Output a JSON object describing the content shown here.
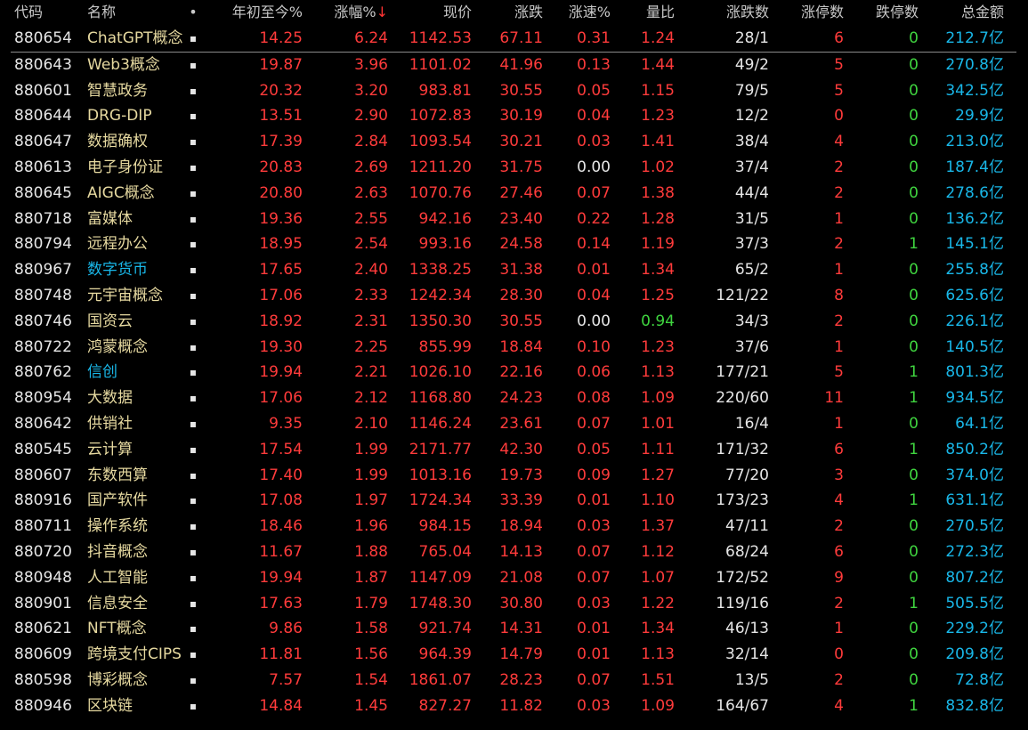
{
  "colors": {
    "up": "#ff3b3b",
    "down": "#3fd43f",
    "neutral": "#e6e6e6",
    "code": "#e6e6e6",
    "name_default": "#e6d9a0",
    "name_highlight": "#19b7e8",
    "amount": "#19b7e8"
  },
  "columns": {
    "code": "代码",
    "name": "名称",
    "dot": "•",
    "ytd": "年初至今%",
    "change": "涨幅%",
    "sort_indicator": "↓",
    "price": "现价",
    "delta": "涨跌",
    "speed": "涨速%",
    "volume_ratio": "量比",
    "adv_dec": "涨跌数",
    "limit_up": "涨停数",
    "limit_down": "跌停数",
    "amount": "总金额"
  },
  "rows": [
    {
      "code": "880654",
      "name": "ChatGPT概念",
      "dot": "▪",
      "ytd": "14.25",
      "change": "6.24",
      "price": "1142.53",
      "delta": "67.11",
      "speed": "0.31",
      "vr": "1.24",
      "adv": "28/1",
      "lu": "6",
      "ld": "0",
      "amt": "212.7亿",
      "vr_color": "up",
      "speed_color": "up",
      "name_color": "name_default"
    },
    {
      "code": "880643",
      "name": "Web3概念",
      "dot": "▪",
      "ytd": "19.87",
      "change": "3.96",
      "price": "1101.02",
      "delta": "41.96",
      "speed": "0.13",
      "vr": "1.44",
      "adv": "49/2",
      "lu": "5",
      "ld": "0",
      "amt": "270.8亿",
      "vr_color": "up",
      "speed_color": "up",
      "name_color": "name_default"
    },
    {
      "code": "880601",
      "name": "智慧政务",
      "dot": "▪",
      "ytd": "20.32",
      "change": "3.20",
      "price": "983.81",
      "delta": "30.55",
      "speed": "0.05",
      "vr": "1.15",
      "adv": "79/5",
      "lu": "5",
      "ld": "0",
      "amt": "342.5亿",
      "vr_color": "up",
      "speed_color": "up",
      "name_color": "name_default"
    },
    {
      "code": "880644",
      "name": "DRG-DIP",
      "dot": "▪",
      "ytd": "13.51",
      "change": "2.90",
      "price": "1072.83",
      "delta": "30.19",
      "speed": "0.04",
      "vr": "1.23",
      "adv": "12/2",
      "lu": "0",
      "ld": "0",
      "amt": "29.9亿",
      "vr_color": "up",
      "speed_color": "up",
      "name_color": "name_default"
    },
    {
      "code": "880647",
      "name": "数据确权",
      "dot": "▪",
      "ytd": "17.39",
      "change": "2.84",
      "price": "1093.54",
      "delta": "30.21",
      "speed": "0.03",
      "vr": "1.41",
      "adv": "38/4",
      "lu": "4",
      "ld": "0",
      "amt": "213.0亿",
      "vr_color": "up",
      "speed_color": "up",
      "name_color": "name_default"
    },
    {
      "code": "880613",
      "name": "电子身份证",
      "dot": "▪",
      "ytd": "20.83",
      "change": "2.69",
      "price": "1211.20",
      "delta": "31.75",
      "speed": "0.00",
      "vr": "1.02",
      "adv": "37/4",
      "lu": "2",
      "ld": "0",
      "amt": "187.4亿",
      "vr_color": "up",
      "speed_color": "neutral",
      "name_color": "name_default"
    },
    {
      "code": "880645",
      "name": "AIGC概念",
      "dot": "▪",
      "ytd": "20.80",
      "change": "2.63",
      "price": "1070.76",
      "delta": "27.46",
      "speed": "0.07",
      "vr": "1.38",
      "adv": "44/4",
      "lu": "2",
      "ld": "0",
      "amt": "278.6亿",
      "vr_color": "up",
      "speed_color": "up",
      "name_color": "name_default"
    },
    {
      "code": "880718",
      "name": "富媒体",
      "dot": "▪",
      "ytd": "19.36",
      "change": "2.55",
      "price": "942.16",
      "delta": "23.40",
      "speed": "0.22",
      "vr": "1.28",
      "adv": "31/5",
      "lu": "1",
      "ld": "0",
      "amt": "136.2亿",
      "vr_color": "up",
      "speed_color": "up",
      "name_color": "name_default"
    },
    {
      "code": "880794",
      "name": "远程办公",
      "dot": "▪",
      "ytd": "18.95",
      "change": "2.54",
      "price": "993.16",
      "delta": "24.58",
      "speed": "0.14",
      "vr": "1.19",
      "adv": "37/3",
      "lu": "2",
      "ld": "1",
      "amt": "145.1亿",
      "vr_color": "up",
      "speed_color": "up",
      "name_color": "name_default"
    },
    {
      "code": "880967",
      "name": "数字货币",
      "dot": "▪",
      "ytd": "17.65",
      "change": "2.40",
      "price": "1338.25",
      "delta": "31.38",
      "speed": "0.01",
      "vr": "1.34",
      "adv": "65/2",
      "lu": "1",
      "ld": "0",
      "amt": "255.8亿",
      "vr_color": "up",
      "speed_color": "up",
      "name_color": "name_highlight"
    },
    {
      "code": "880748",
      "name": "元宇宙概念",
      "dot": "▪",
      "ytd": "17.06",
      "change": "2.33",
      "price": "1242.34",
      "delta": "28.30",
      "speed": "0.04",
      "vr": "1.25",
      "adv": "121/22",
      "lu": "8",
      "ld": "0",
      "amt": "625.6亿",
      "vr_color": "up",
      "speed_color": "up",
      "name_color": "name_default"
    },
    {
      "code": "880746",
      "name": "国资云",
      "dot": "▪",
      "ytd": "18.92",
      "change": "2.31",
      "price": "1350.30",
      "delta": "30.55",
      "speed": "0.00",
      "vr": "0.94",
      "adv": "34/3",
      "lu": "2",
      "ld": "0",
      "amt": "226.1亿",
      "vr_color": "down",
      "speed_color": "neutral",
      "name_color": "name_default"
    },
    {
      "code": "880722",
      "name": "鸿蒙概念",
      "dot": "▪",
      "ytd": "19.30",
      "change": "2.25",
      "price": "855.99",
      "delta": "18.84",
      "speed": "0.10",
      "vr": "1.23",
      "adv": "37/6",
      "lu": "1",
      "ld": "0",
      "amt": "140.5亿",
      "vr_color": "up",
      "speed_color": "up",
      "name_color": "name_default"
    },
    {
      "code": "880762",
      "name": "信创",
      "dot": "▪",
      "ytd": "19.94",
      "change": "2.21",
      "price": "1026.10",
      "delta": "22.16",
      "speed": "0.06",
      "vr": "1.13",
      "adv": "177/21",
      "lu": "5",
      "ld": "1",
      "amt": "801.3亿",
      "vr_color": "up",
      "speed_color": "up",
      "name_color": "name_highlight"
    },
    {
      "code": "880954",
      "name": "大数据",
      "dot": "▪",
      "ytd": "17.06",
      "change": "2.12",
      "price": "1168.80",
      "delta": "24.23",
      "speed": "0.08",
      "vr": "1.09",
      "adv": "220/60",
      "lu": "11",
      "ld": "1",
      "amt": "934.5亿",
      "vr_color": "up",
      "speed_color": "up",
      "name_color": "name_default"
    },
    {
      "code": "880642",
      "name": "供销社",
      "dot": "▪",
      "ytd": "9.35",
      "change": "2.10",
      "price": "1146.24",
      "delta": "23.61",
      "speed": "0.07",
      "vr": "1.01",
      "adv": "16/4",
      "lu": "1",
      "ld": "0",
      "amt": "64.1亿",
      "vr_color": "up",
      "speed_color": "up",
      "name_color": "name_default"
    },
    {
      "code": "880545",
      "name": "云计算",
      "dot": "▪",
      "ytd": "17.54",
      "change": "1.99",
      "price": "2171.77",
      "delta": "42.30",
      "speed": "0.05",
      "vr": "1.11",
      "adv": "171/32",
      "lu": "6",
      "ld": "1",
      "amt": "850.2亿",
      "vr_color": "up",
      "speed_color": "up",
      "name_color": "name_default"
    },
    {
      "code": "880607",
      "name": "东数西算",
      "dot": "▪",
      "ytd": "17.40",
      "change": "1.99",
      "price": "1013.16",
      "delta": "19.73",
      "speed": "0.09",
      "vr": "1.27",
      "adv": "77/20",
      "lu": "3",
      "ld": "0",
      "amt": "374.0亿",
      "vr_color": "up",
      "speed_color": "up",
      "name_color": "name_default"
    },
    {
      "code": "880916",
      "name": "国产软件",
      "dot": "▪",
      "ytd": "17.08",
      "change": "1.97",
      "price": "1724.34",
      "delta": "33.39",
      "speed": "0.01",
      "vr": "1.10",
      "adv": "173/23",
      "lu": "4",
      "ld": "1",
      "amt": "631.1亿",
      "vr_color": "up",
      "speed_color": "up",
      "name_color": "name_default"
    },
    {
      "code": "880711",
      "name": "操作系统",
      "dot": "▪",
      "ytd": "18.46",
      "change": "1.96",
      "price": "984.15",
      "delta": "18.94",
      "speed": "0.03",
      "vr": "1.37",
      "adv": "47/11",
      "lu": "2",
      "ld": "0",
      "amt": "270.5亿",
      "vr_color": "up",
      "speed_color": "up",
      "name_color": "name_default"
    },
    {
      "code": "880720",
      "name": "抖音概念",
      "dot": "▪",
      "ytd": "11.67",
      "change": "1.88",
      "price": "765.04",
      "delta": "14.13",
      "speed": "0.07",
      "vr": "1.12",
      "adv": "68/24",
      "lu": "6",
      "ld": "0",
      "amt": "272.3亿",
      "vr_color": "up",
      "speed_color": "up",
      "name_color": "name_default"
    },
    {
      "code": "880948",
      "name": "人工智能",
      "dot": "▪",
      "ytd": "19.94",
      "change": "1.87",
      "price": "1147.09",
      "delta": "21.08",
      "speed": "0.07",
      "vr": "1.07",
      "adv": "172/52",
      "lu": "9",
      "ld": "0",
      "amt": "807.2亿",
      "vr_color": "up",
      "speed_color": "up",
      "name_color": "name_default"
    },
    {
      "code": "880901",
      "name": "信息安全",
      "dot": "▪",
      "ytd": "17.63",
      "change": "1.79",
      "price": "1748.30",
      "delta": "30.80",
      "speed": "0.03",
      "vr": "1.22",
      "adv": "119/16",
      "lu": "2",
      "ld": "1",
      "amt": "505.5亿",
      "vr_color": "up",
      "speed_color": "up",
      "name_color": "name_default"
    },
    {
      "code": "880621",
      "name": "NFT概念",
      "dot": "▪",
      "ytd": "9.86",
      "change": "1.58",
      "price": "921.74",
      "delta": "14.31",
      "speed": "0.01",
      "vr": "1.34",
      "adv": "46/13",
      "lu": "1",
      "ld": "0",
      "amt": "229.2亿",
      "vr_color": "up",
      "speed_color": "up",
      "name_color": "name_default"
    },
    {
      "code": "880609",
      "name": "跨境支付CIPS",
      "dot": "▪",
      "ytd": "11.81",
      "change": "1.56",
      "price": "964.39",
      "delta": "14.79",
      "speed": "0.01",
      "vr": "1.13",
      "adv": "32/14",
      "lu": "0",
      "ld": "0",
      "amt": "209.8亿",
      "vr_color": "up",
      "speed_color": "up",
      "name_color": "name_default"
    },
    {
      "code": "880598",
      "name": "博彩概念",
      "dot": "▪",
      "ytd": "7.57",
      "change": "1.54",
      "price": "1861.07",
      "delta": "28.23",
      "speed": "0.07",
      "vr": "1.51",
      "adv": "13/5",
      "lu": "2",
      "ld": "0",
      "amt": "72.8亿",
      "vr_color": "up",
      "speed_color": "up",
      "name_color": "name_default"
    },
    {
      "code": "880946",
      "name": "区块链",
      "dot": "▪",
      "ytd": "14.84",
      "change": "1.45",
      "price": "827.27",
      "delta": "11.82",
      "speed": "0.03",
      "vr": "1.09",
      "adv": "164/67",
      "lu": "4",
      "ld": "1",
      "amt": "832.8亿",
      "vr_color": "up",
      "speed_color": "up",
      "name_color": "name_default"
    }
  ]
}
